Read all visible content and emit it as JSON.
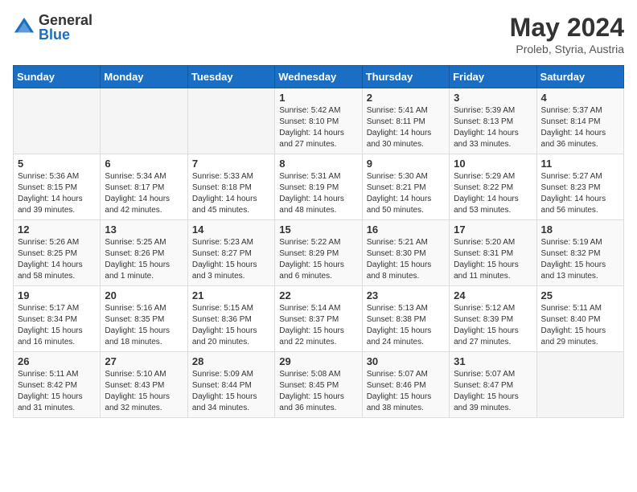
{
  "logo": {
    "general": "General",
    "blue": "Blue"
  },
  "header": {
    "month_year": "May 2024",
    "location": "Proleb, Styria, Austria"
  },
  "days_of_week": [
    "Sunday",
    "Monday",
    "Tuesday",
    "Wednesday",
    "Thursday",
    "Friday",
    "Saturday"
  ],
  "weeks": [
    [
      {
        "day": "",
        "info": ""
      },
      {
        "day": "",
        "info": ""
      },
      {
        "day": "",
        "info": ""
      },
      {
        "day": "1",
        "info": "Sunrise: 5:42 AM\nSunset: 8:10 PM\nDaylight: 14 hours\nand 27 minutes."
      },
      {
        "day": "2",
        "info": "Sunrise: 5:41 AM\nSunset: 8:11 PM\nDaylight: 14 hours\nand 30 minutes."
      },
      {
        "day": "3",
        "info": "Sunrise: 5:39 AM\nSunset: 8:13 PM\nDaylight: 14 hours\nand 33 minutes."
      },
      {
        "day": "4",
        "info": "Sunrise: 5:37 AM\nSunset: 8:14 PM\nDaylight: 14 hours\nand 36 minutes."
      }
    ],
    [
      {
        "day": "5",
        "info": "Sunrise: 5:36 AM\nSunset: 8:15 PM\nDaylight: 14 hours\nand 39 minutes."
      },
      {
        "day": "6",
        "info": "Sunrise: 5:34 AM\nSunset: 8:17 PM\nDaylight: 14 hours\nand 42 minutes."
      },
      {
        "day": "7",
        "info": "Sunrise: 5:33 AM\nSunset: 8:18 PM\nDaylight: 14 hours\nand 45 minutes."
      },
      {
        "day": "8",
        "info": "Sunrise: 5:31 AM\nSunset: 8:19 PM\nDaylight: 14 hours\nand 48 minutes."
      },
      {
        "day": "9",
        "info": "Sunrise: 5:30 AM\nSunset: 8:21 PM\nDaylight: 14 hours\nand 50 minutes."
      },
      {
        "day": "10",
        "info": "Sunrise: 5:29 AM\nSunset: 8:22 PM\nDaylight: 14 hours\nand 53 minutes."
      },
      {
        "day": "11",
        "info": "Sunrise: 5:27 AM\nSunset: 8:23 PM\nDaylight: 14 hours\nand 56 minutes."
      }
    ],
    [
      {
        "day": "12",
        "info": "Sunrise: 5:26 AM\nSunset: 8:25 PM\nDaylight: 14 hours\nand 58 minutes."
      },
      {
        "day": "13",
        "info": "Sunrise: 5:25 AM\nSunset: 8:26 PM\nDaylight: 15 hours\nand 1 minute."
      },
      {
        "day": "14",
        "info": "Sunrise: 5:23 AM\nSunset: 8:27 PM\nDaylight: 15 hours\nand 3 minutes."
      },
      {
        "day": "15",
        "info": "Sunrise: 5:22 AM\nSunset: 8:29 PM\nDaylight: 15 hours\nand 6 minutes."
      },
      {
        "day": "16",
        "info": "Sunrise: 5:21 AM\nSunset: 8:30 PM\nDaylight: 15 hours\nand 8 minutes."
      },
      {
        "day": "17",
        "info": "Sunrise: 5:20 AM\nSunset: 8:31 PM\nDaylight: 15 hours\nand 11 minutes."
      },
      {
        "day": "18",
        "info": "Sunrise: 5:19 AM\nSunset: 8:32 PM\nDaylight: 15 hours\nand 13 minutes."
      }
    ],
    [
      {
        "day": "19",
        "info": "Sunrise: 5:17 AM\nSunset: 8:34 PM\nDaylight: 15 hours\nand 16 minutes."
      },
      {
        "day": "20",
        "info": "Sunrise: 5:16 AM\nSunset: 8:35 PM\nDaylight: 15 hours\nand 18 minutes."
      },
      {
        "day": "21",
        "info": "Sunrise: 5:15 AM\nSunset: 8:36 PM\nDaylight: 15 hours\nand 20 minutes."
      },
      {
        "day": "22",
        "info": "Sunrise: 5:14 AM\nSunset: 8:37 PM\nDaylight: 15 hours\nand 22 minutes."
      },
      {
        "day": "23",
        "info": "Sunrise: 5:13 AM\nSunset: 8:38 PM\nDaylight: 15 hours\nand 24 minutes."
      },
      {
        "day": "24",
        "info": "Sunrise: 5:12 AM\nSunset: 8:39 PM\nDaylight: 15 hours\nand 27 minutes."
      },
      {
        "day": "25",
        "info": "Sunrise: 5:11 AM\nSunset: 8:40 PM\nDaylight: 15 hours\nand 29 minutes."
      }
    ],
    [
      {
        "day": "26",
        "info": "Sunrise: 5:11 AM\nSunset: 8:42 PM\nDaylight: 15 hours\nand 31 minutes."
      },
      {
        "day": "27",
        "info": "Sunrise: 5:10 AM\nSunset: 8:43 PM\nDaylight: 15 hours\nand 32 minutes."
      },
      {
        "day": "28",
        "info": "Sunrise: 5:09 AM\nSunset: 8:44 PM\nDaylight: 15 hours\nand 34 minutes."
      },
      {
        "day": "29",
        "info": "Sunrise: 5:08 AM\nSunset: 8:45 PM\nDaylight: 15 hours\nand 36 minutes."
      },
      {
        "day": "30",
        "info": "Sunrise: 5:07 AM\nSunset: 8:46 PM\nDaylight: 15 hours\nand 38 minutes."
      },
      {
        "day": "31",
        "info": "Sunrise: 5:07 AM\nSunset: 8:47 PM\nDaylight: 15 hours\nand 39 minutes."
      },
      {
        "day": "",
        "info": ""
      }
    ]
  ]
}
